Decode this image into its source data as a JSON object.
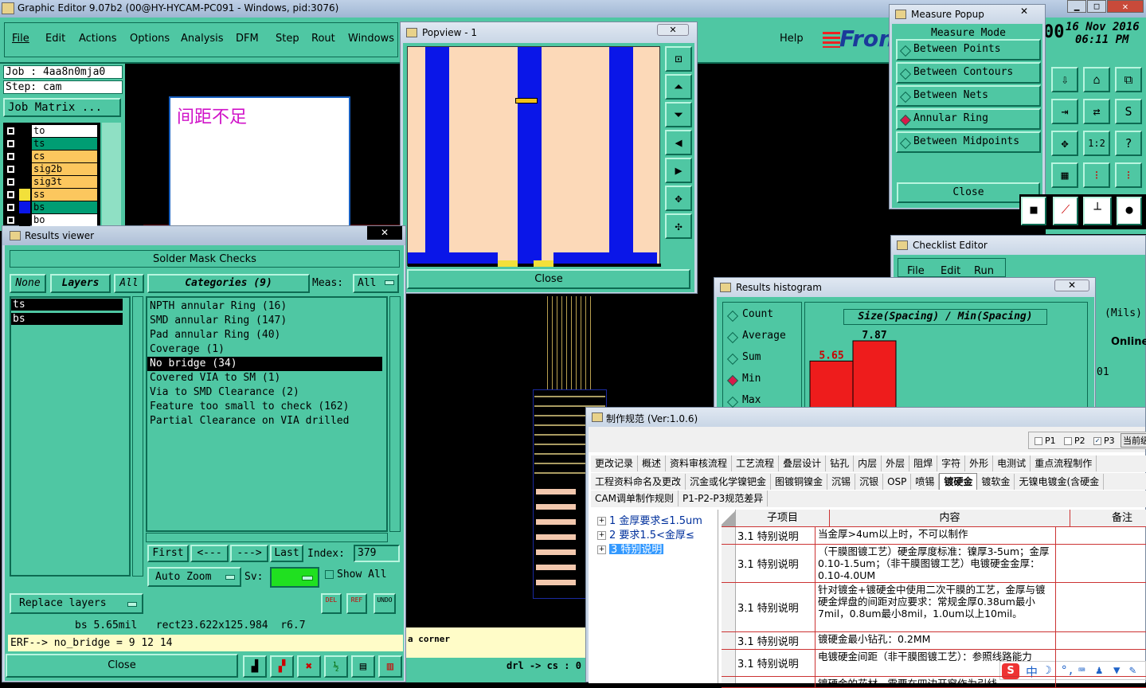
{
  "app": {
    "title": "Graphic Editor 9.07b2 (00@HY-HYCAM-PC091 - Windows, pid:3076)",
    "menu": [
      "File",
      "Edit",
      "Actions",
      "Options",
      "Analysis",
      "DFM",
      "Step",
      "Rout",
      "Windows"
    ],
    "help": "Help",
    "brand": "Fron",
    "date": "16 Nov 2016",
    "time": "06:11 PM",
    "date_prefix": "00",
    "job": "Job : 4aa8n0mja0",
    "step": "Step: cam",
    "job_matrix": "Job Matrix ...",
    "layers": [
      {
        "name": "to",
        "color": "#ffffff"
      },
      {
        "name": "ts",
        "color": "#009d73"
      },
      {
        "name": "cs",
        "color": "#fcc75e"
      },
      {
        "name": "sig2b",
        "color": "#fcc75e"
      },
      {
        "name": "sig3t",
        "color": "#fcc75e"
      },
      {
        "name": "ss",
        "color": "#fcc75e"
      },
      {
        "name": "bs",
        "color": "#009d73"
      },
      {
        "name": "bo",
        "color": "#ffffff"
      }
    ],
    "note_popup": "间距不足"
  },
  "results_viewer": {
    "title": "Results viewer",
    "header": "Solder Mask Checks",
    "none": "None",
    "layers": "Layers",
    "all": "All",
    "categories": "Categories (9)",
    "meas_label": "Meas:",
    "meas_value": "All",
    "layer_list": [
      "ts",
      "bs"
    ],
    "category_list": [
      "NPTH annular Ring (16)",
      "SMD annular Ring (147)",
      "Pad annular Ring (40)",
      "Coverage (1)",
      "No bridge (34)",
      "Covered VIA to SM (1)",
      "Via to SMD Clearance (2)",
      "Feature too small to check (162)",
      "Partial Clearance on VIA drilled"
    ],
    "selected_category": 4,
    "first": "First",
    "prev": "<---",
    "next": "--->",
    "last": "Last",
    "index_label": "Index:",
    "index_value": "379",
    "auto_zoom": "Auto Zoom",
    "sv_label": "Sv:",
    "show_all": "Show All",
    "replace_layers": "Replace layers",
    "del": "DEL",
    "ref": "REF",
    "undo": "UNDO",
    "info_line": "bs 5.65mil   rect23.622x125.984  r6.7",
    "erf_line": "ERF--> no_bridge = 9 12 14",
    "close": "Close"
  },
  "popview": {
    "title": "Popview - 1",
    "close": "Close"
  },
  "measure_popup": {
    "title": "Measure Popup",
    "mode_label": "Measure Mode",
    "options": [
      "Between Points",
      "Between Contours",
      "Between Nets",
      "Annular Ring",
      "Between Midpoints"
    ],
    "selected": 3,
    "close": "Close"
  },
  "checklist_editor": {
    "title": "Checklist Editor",
    "menu": [
      "File",
      "Edit",
      "Run"
    ],
    "side_labels": [
      "(Mils)",
      "Online",
      "01"
    ]
  },
  "histogram": {
    "title": "Results histogram",
    "options": [
      "Count",
      "Average",
      "Sum",
      "Min",
      "Max"
    ],
    "selected": 3,
    "chart_title": "Size(Spacing) / Min(Spacing)",
    "chart_data": {
      "type": "bar",
      "values": [
        5.65,
        7.87
      ],
      "title": "Size(Spacing) / Min(Spacing)"
    }
  },
  "spec_window": {
    "title": "制作规范 (Ver:1.0.6)",
    "checks": [
      "P1",
      "P2",
      "P3"
    ],
    "checks_state": [
      false,
      false,
      true
    ],
    "current_btn": "当前级",
    "tabs_row1": [
      "更改记录",
      "概述",
      "资料审核流程",
      "工艺流程",
      "叠层设计",
      "钻孔",
      "内层",
      "外层",
      "阻焊",
      "字符",
      "外形",
      "电测试",
      "重点流程制作"
    ],
    "tabs_row2": [
      "工程资料命名及更改",
      "沉金或化学镍钯金",
      "图镀铜镍金",
      "沉锡",
      "沉银",
      "OSP",
      "喷锡",
      "镀硬金",
      "镀软金",
      "无镍电镀金(含硬金"
    ],
    "tabs_row2_selected": 7,
    "tabs_row3": [
      "CAM调单制作规则",
      "P1-P2-P3规范差异"
    ],
    "tree": [
      "1 金厚要求≤1.5um",
      "2 要求1.5<金厚≤",
      "3 特别说明"
    ],
    "tree_selected": 2,
    "col_sub": "子项目",
    "col_content": "内容",
    "col_note": "备注",
    "rows": [
      {
        "sub": "3.1 特别说明",
        "content": "当金厚>4um以上时，不可以制作"
      },
      {
        "sub": "3.1 特别说明",
        "content": "（干膜图镀工艺）硬金厚度标准：镍厚3-5um；金厚0.10-1.5um；（非干膜图镀工艺）电镀硬金金厚：0.10-4.0UM"
      },
      {
        "sub": "3.1 特别说明",
        "content": "针对镀金+镀硬金中使用二次干膜的工艺，金厚与镀硬金焊盘的间距对应要求：常规金厚0.38um最小7mil，0.8um最小8mil，1.0um以上10mil。"
      },
      {
        "sub": "3.1 特别说明",
        "content": "镀硬金最小钻孔：0.2MM"
      },
      {
        "sub": "3.1 特别说明",
        "content": "电镀硬金间距（非干膜图镀工艺）：参照线路能力"
      },
      {
        "sub": "",
        "content": "镀硬金的花材，需要在四边开窗作为引线"
      }
    ]
  },
  "bottom_bar": {
    "corner_text": "a corner",
    "drl_text": "drl -> cs : 0"
  },
  "ime": {
    "label": "中"
  }
}
